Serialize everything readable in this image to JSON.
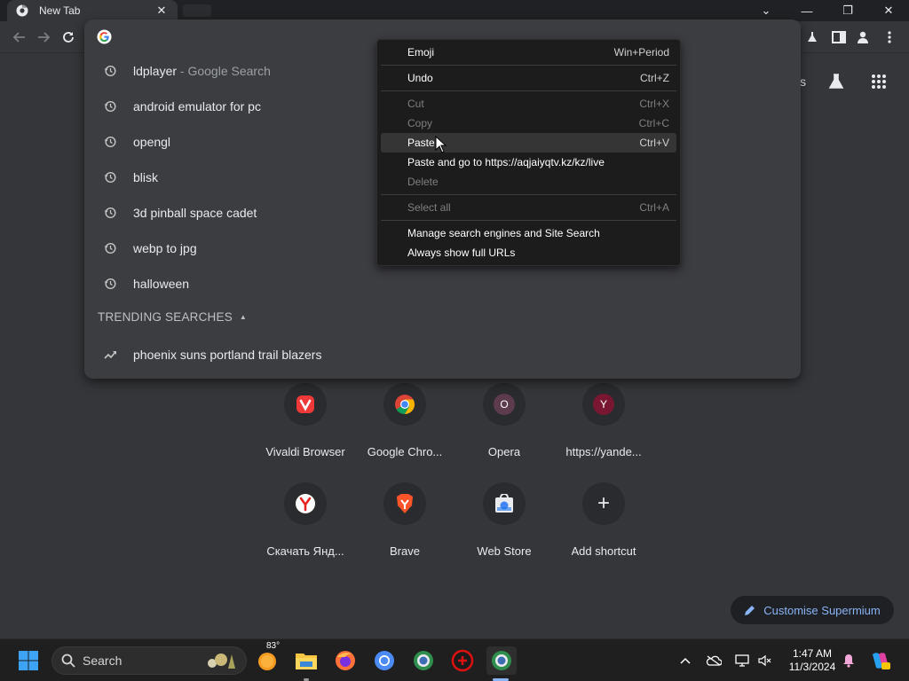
{
  "browser": {
    "tab_title": "New Tab",
    "tab_close": "✕"
  },
  "window_controls": {
    "dropdown": "⌄",
    "minimize": "—",
    "restore": "❐",
    "close": "✕"
  },
  "omnibox": {
    "suggestions": [
      {
        "text": "ldplayer",
        "sub": " - Google Search",
        "icon": "history-icon"
      },
      {
        "text": "android emulator for pc",
        "sub": "",
        "icon": "history-icon"
      },
      {
        "text": "opengl",
        "sub": "",
        "icon": "history-icon"
      },
      {
        "text": "blisk",
        "sub": "",
        "icon": "history-icon"
      },
      {
        "text": "3d pinball space cadet",
        "sub": "",
        "icon": "history-icon"
      },
      {
        "text": "webp to jpg",
        "sub": "",
        "icon": "history-icon"
      },
      {
        "text": "halloween",
        "sub": "",
        "icon": "history-icon"
      }
    ],
    "trending_header": "TRENDING SEARCHES",
    "trending": [
      {
        "text": "phoenix suns portland trail blazers",
        "icon": "trending-icon"
      }
    ]
  },
  "context_menu": {
    "items": [
      {
        "label": "Emoji",
        "shortcut": "Win+Period",
        "enabled": true
      },
      {
        "label": "Undo",
        "shortcut": "Ctrl+Z",
        "enabled": true
      },
      {
        "label": "Cut",
        "shortcut": "Ctrl+X",
        "enabled": false
      },
      {
        "label": "Copy",
        "shortcut": "Ctrl+C",
        "enabled": false
      },
      {
        "label": "Paste",
        "shortcut": "Ctrl+V",
        "enabled": true
      },
      {
        "label": "Paste and go to https://aqjaiyqtv.kz/kz/live",
        "shortcut": "",
        "enabled": true
      },
      {
        "label": "Delete",
        "shortcut": "",
        "enabled": false
      },
      {
        "label": "Select all",
        "shortcut": "Ctrl+A",
        "enabled": false
      },
      {
        "label": "Manage search engines and Site Search",
        "shortcut": "",
        "enabled": true
      },
      {
        "label": "Always show full URLs",
        "shortcut": "",
        "enabled": true
      }
    ]
  },
  "ntp": {
    "partial_text": "s",
    "shortcuts": [
      {
        "label": "Vivaldi Browser",
        "icon": "vivaldi-icon"
      },
      {
        "label": "Google Chro...",
        "icon": "chrome-icon"
      },
      {
        "label": "Opera",
        "icon": "opera-icon",
        "glyph": "O"
      },
      {
        "label": "https://yande...",
        "icon": "yandex-icon",
        "glyph": "Y"
      },
      {
        "label": "Скачать Янд...",
        "icon": "yandex-browser-icon"
      },
      {
        "label": "Brave",
        "icon": "brave-icon"
      },
      {
        "label": "Web Store",
        "icon": "web-store-icon"
      },
      {
        "label": "Add shortcut",
        "icon": "plus-icon",
        "glyph": "+"
      }
    ],
    "customise_label": "Customise Supermium"
  },
  "taskbar": {
    "search_placeholder": "Search",
    "weather_temp": "83°",
    "time": "1:47 AM",
    "date": "11/3/2024"
  },
  "colors": {
    "accent_link": "#8ab4f8",
    "menu_bg": "#1c1c1c",
    "page_bg": "#35363a"
  }
}
